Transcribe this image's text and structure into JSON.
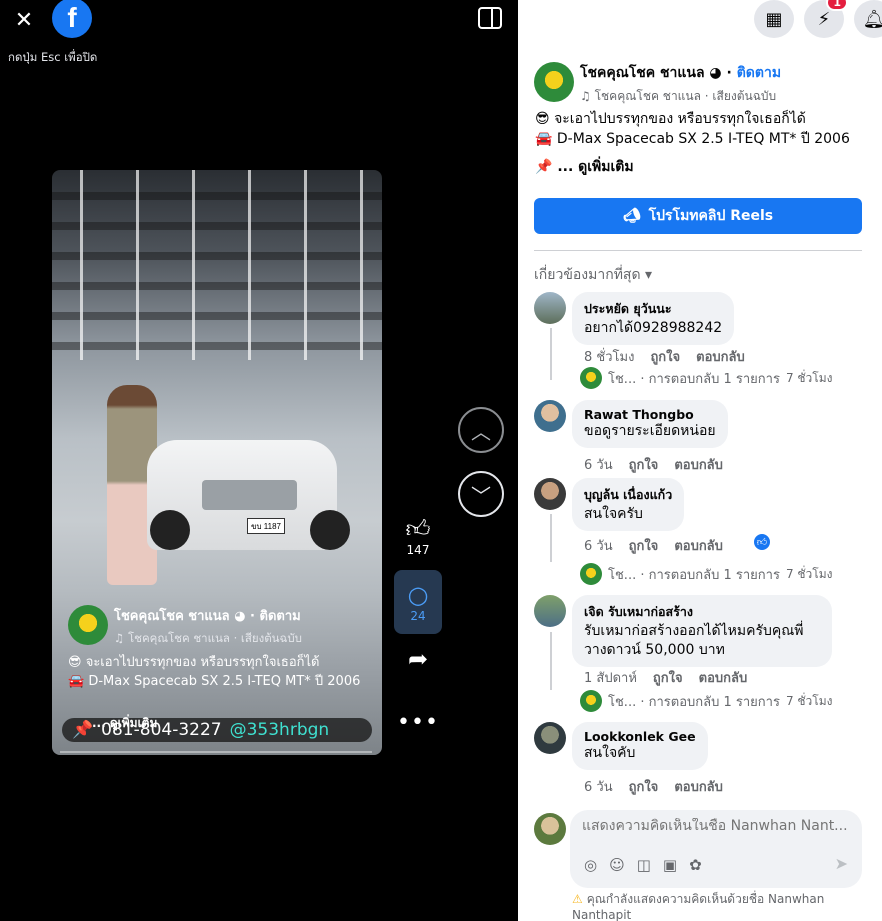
{
  "viewer": {
    "esc_hint": "กดปุ่ม Esc เพื่อปิด",
    "facebook_logo": "f",
    "like_count": "147",
    "comment_count": "24"
  },
  "video": {
    "page_name": "โชคคุณโชค ชาแนล",
    "follow": "ติดตาม",
    "audio": "โชคคุณโชค ชาแนล · เสียงต้นฉบับ",
    "line1": "จะเอาไปบรรทุกของ หรือบรรทุกใจเธอก็ได้",
    "line2": "D-Max Spacecab SX 2.5 I-TEQ MT* ปี 2006",
    "phone": "081-804-3227",
    "line_id": "@353hrbgn",
    "see_more": "... ดูเพิ่มเติม",
    "plate": "ขบ 1187"
  },
  "header": {
    "messenger_badge": "1"
  },
  "post": {
    "page_name": "โชคคุณโชค ชาแนล",
    "follow": "ติดตาม",
    "audio": "โชคคุณโชค ชาแนล · เสียงต้นฉบับ",
    "line1": "จะเอาไปบรรทุกของ หรือบรรทุกใจเธอก็ได้",
    "line2": "D-Max Spacecab SX 2.5 I-TEQ MT* ปี 2006",
    "see_more": "... ดูเพิ่มเติม",
    "promote": "โปรโมทคลิป Reels",
    "sort": "เกี่ยวข้องมากที่สุด"
  },
  "comments": [
    {
      "name": "ประหยัด ยุวันนะ",
      "text": "อยากได้0928988242",
      "time": "8 ชั่วโมง",
      "like": "ถูกใจ",
      "reply": "ตอบกลับ",
      "reply_summary": "โช... · การตอบกลับ 1 รายการ",
      "reply_time": "7 ชั่วโมง"
    },
    {
      "name": "Rawat Thongbo",
      "text": "ขอดูรายระเอียดหน่อย",
      "time": "6 วัน",
      "like": "ถูกใจ",
      "reply": "ตอบกลับ"
    },
    {
      "name": "บุญล้น เนื่องแก้ว",
      "text": "สนใจครับ",
      "time": "6 วัน",
      "like": "ถูกใจ",
      "reply": "ตอบกลับ",
      "reply_summary": "โช... · การตอบกลับ 1 รายการ",
      "reply_time": "7 ชั่วโมง"
    },
    {
      "name": "เจิด รับเหมาก่อสร้าง",
      "text": "รับเหมาก่อสร้างออกได้ไหมครับคุณพี่วางดาวน์ 50,000 บาท",
      "time": "1 สัปดาห์",
      "like": "ถูกใจ",
      "reply": "ตอบกลับ",
      "reply_summary": "โช... · การตอบกลับ 1 รายการ",
      "reply_time": "7 ชั่วโมง"
    },
    {
      "name": "Lookkonlek Gee",
      "text": "สนใจคับ",
      "time": "6 วัน",
      "like": "ถูกใจ",
      "reply": "ตอบกลับ"
    }
  ],
  "composer": {
    "placeholder": "แสดงความคิดเห็นในชื่อ Nanwhan Nant...",
    "warning": "คุณกำลังแสดงความคิดเห็นด้วยชื่อ Nanwhan Nanthapit"
  }
}
